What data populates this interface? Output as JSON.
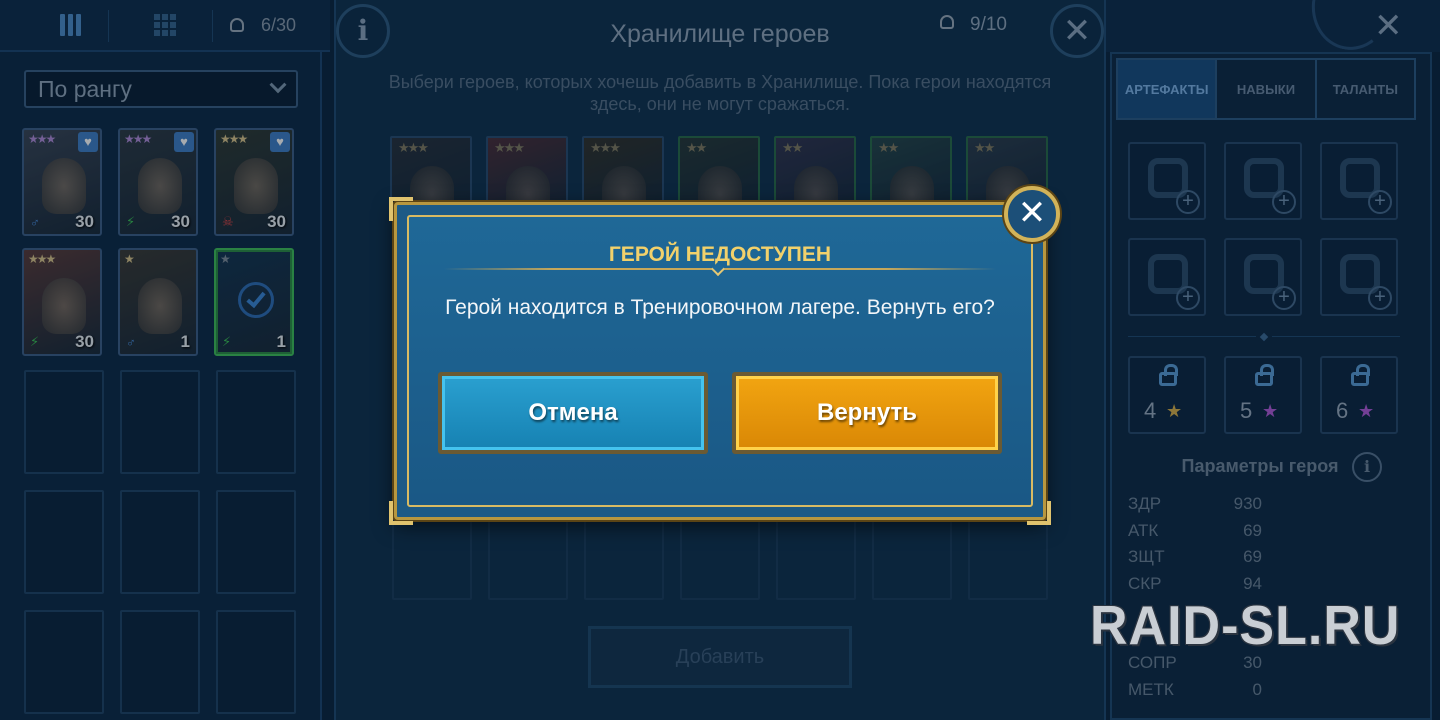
{
  "topbar": {
    "roster_slots": "6/30"
  },
  "roster": {
    "sort_label": "По рангу",
    "heroes": [
      {
        "stars": "★★★",
        "level": "30",
        "star_color": "#b08ad8",
        "favorite": true,
        "affinity_icon": "magic-icon",
        "tint": "#3a4556"
      },
      {
        "stars": "★★★",
        "level": "30",
        "star_color": "#b08ad8",
        "favorite": true,
        "affinity_icon": "spirit-icon",
        "tint": "#2d3a44"
      },
      {
        "stars": "★★★",
        "level": "30",
        "star_color": "#d9c48a",
        "favorite": true,
        "affinity_icon": "force-icon",
        "tint": "#2f3a34"
      },
      {
        "stars": "★★★",
        "level": "30",
        "star_color": "#d9c48a",
        "favorite": false,
        "affinity_icon": "spirit-icon",
        "tint": "#5a3b3a"
      },
      {
        "stars": "★",
        "level": "1",
        "star_color": "#d9c48a",
        "favorite": false,
        "affinity_icon": "magic-icon",
        "tint": "#3b3a36"
      },
      {
        "stars": "★",
        "level": "1",
        "star_color": "#7f8c9a",
        "favorite": false,
        "affinity_icon": "spirit-icon",
        "tint": "#143552",
        "selected": true
      }
    ]
  },
  "vault": {
    "title": "Хранилище героев",
    "count": "9/10",
    "hint": "Выбери героев, которых хочешь добавить в Хранилище. Пока герои находятся здесь, они не могут сражаться.",
    "cards": [
      {
        "stars": "★★★",
        "tint": "#2e3138"
      },
      {
        "stars": "★★★",
        "tint": "#5a2e34"
      },
      {
        "stars": "★★★",
        "tint": "#3b3324"
      },
      {
        "stars": "★★",
        "tint": "#2e3a33"
      },
      {
        "stars": "★★",
        "tint": "#3a3550"
      },
      {
        "stars": "★★",
        "tint": "#2b4a4a"
      },
      {
        "stars": "★★",
        "tint": "#33404e"
      }
    ],
    "add_label": "Добавить"
  },
  "right": {
    "tabs": [
      {
        "label": "АРТЕФАКТЫ",
        "active": true
      },
      {
        "label": "НАВЫКИ",
        "active": false
      },
      {
        "label": "ТАЛАНТЫ",
        "active": false
      }
    ],
    "artifact_slots": [
      "weapon-icon",
      "helmet-icon",
      "shield-icon",
      "gauntlets-icon",
      "chestplate-icon",
      "boots-icon"
    ],
    "locked_slots": [
      {
        "number": "4",
        "star_color": "#d7b04a"
      },
      {
        "number": "5",
        "star_color": "#b05ad8"
      },
      {
        "number": "6",
        "star_color": "#b05ad8"
      }
    ],
    "params_title": "Параметры героя",
    "stats": [
      {
        "name": "ЗДР",
        "value": "930"
      },
      {
        "name": "АТК",
        "value": "69"
      },
      {
        "name": "ЗЩТ",
        "value": "69"
      },
      {
        "name": "СКР",
        "value": "94"
      },
      {
        "name": "",
        "value": ""
      },
      {
        "name": "",
        "value": ""
      },
      {
        "name": "СОПР",
        "value": "30"
      },
      {
        "name": "МЕТК",
        "value": "0"
      }
    ]
  },
  "dialog": {
    "title": "ГЕРОЙ НЕДОСТУПЕН",
    "message": "Герой находится в Тренировочном лагере. Вернуть его?",
    "cancel_label": "Отмена",
    "confirm_label": "Вернуть",
    "close_symbol": "✕"
  },
  "watermark": "RAID-SL.RU",
  "colors": {
    "accent_gold": "#f2d16b",
    "cancel_blue": "#1f8fc2",
    "confirm_orange": "#e8960b"
  }
}
